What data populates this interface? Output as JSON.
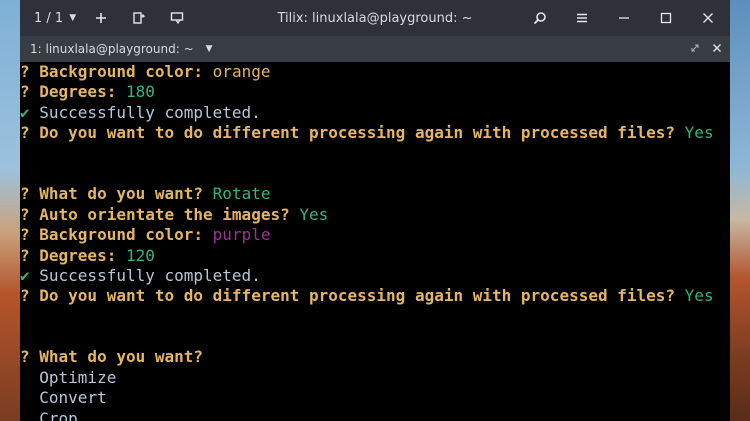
{
  "window": {
    "title": "Tilix: linuxlala@playground: ~",
    "session_count": "1 / 1",
    "tab_label": "1: linuxlala@playground: ~"
  },
  "icons": {
    "add": "plus-icon",
    "sidebar": "sidebar-toggle-icon",
    "sync": "notification-icon",
    "search": "search-icon",
    "menu": "hamburger-menu-icon",
    "minimize": "minimize-icon",
    "maximize": "maximize-icon",
    "close": "close-icon",
    "tab_maximize": "expand-icon",
    "tab_close": "close-icon"
  },
  "colors": {
    "question": "#e5b566",
    "answer": "#36b37e",
    "success": "#36b37e",
    "purple": "#a0309e",
    "text": "#c9d1d9"
  },
  "terminal": {
    "lines": [
      {
        "prefix": "? ",
        "question": "Background color:",
        "answer": "orange",
        "answer_style": "orange"
      },
      {
        "prefix": "? ",
        "question": "Degrees:",
        "answer": "180",
        "answer_style": "green"
      },
      {
        "prefix": "✔ ",
        "text": "Successfully completed.",
        "style": "success"
      },
      {
        "prefix": "? ",
        "question": "Do you want to do different processing again with processed files?",
        "answer": "Yes",
        "answer_style": "green"
      },
      {
        "blank": true
      },
      {
        "blank": true
      },
      {
        "prefix": "? ",
        "question": "What do you want?",
        "answer": "Rotate",
        "answer_style": "green"
      },
      {
        "prefix": "? ",
        "question": "Auto orientate the images?",
        "answer": "Yes",
        "answer_style": "green"
      },
      {
        "prefix": "? ",
        "question": "Background color:",
        "answer": "purple",
        "answer_style": "purple"
      },
      {
        "prefix": "? ",
        "question": "Degrees:",
        "answer": "120",
        "answer_style": "green"
      },
      {
        "prefix": "✔ ",
        "text": "Successfully completed.",
        "style": "success"
      },
      {
        "prefix": "? ",
        "question": "Do you want to do different processing again with processed files?",
        "answer": "Yes",
        "answer_style": "green"
      },
      {
        "blank": true
      },
      {
        "blank": true
      },
      {
        "prefix": "? ",
        "question": "What do you want?",
        "answer": "",
        "answer_style": "green"
      },
      {
        "prefix": "  ",
        "text": "Optimize",
        "style": "option"
      },
      {
        "prefix": "  ",
        "text": "Convert",
        "style": "option"
      },
      {
        "prefix": "  ",
        "text": "Crop",
        "style": "option"
      }
    ]
  }
}
